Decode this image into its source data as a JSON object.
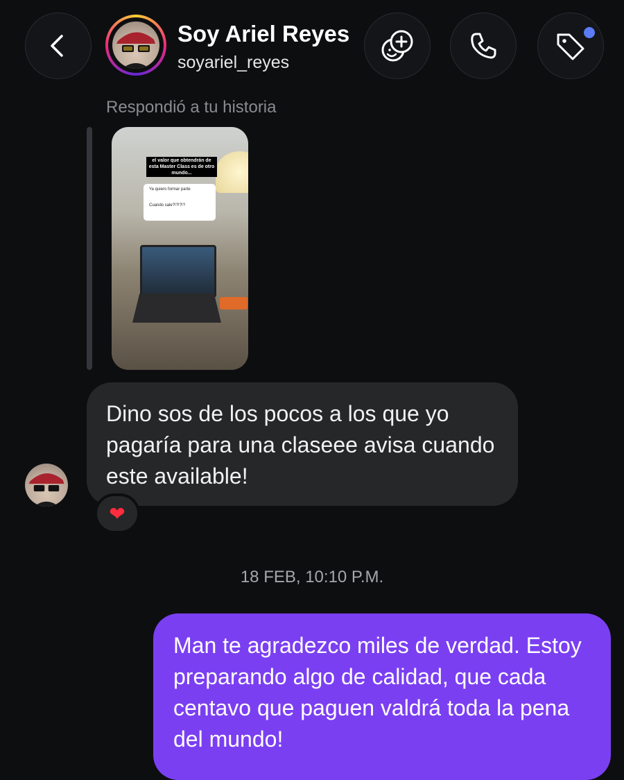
{
  "header": {
    "display_name": "Soy Ariel Reyes",
    "username": "soyariel_reyes"
  },
  "reply": {
    "label": "Respondió a tu historia",
    "story_caption": "el valor que obtendrán de esta Master Class es de otro mundo...",
    "story_card_option_1": "Ya quiero formar parte",
    "story_card_option_2": "Cuando sale?!?!?!?"
  },
  "messages": [
    {
      "from": "contact",
      "text": "Dino sos de los pocos a los que yo pagaría para una claseee avisa cuando este available!",
      "reaction": "❤"
    },
    {
      "from": "me",
      "text": "Man te agradezco miles de verdad. Estoy preparando algo de calidad, que cada centavo que paguen valdrá toda la pena del mundo!"
    }
  ],
  "timestamp": "18 FEB, 10:10 P.M.",
  "icons": {
    "back": "chevron-left-icon",
    "effects": "emoji-add-icon",
    "call": "phone-icon",
    "tag": "tag-icon"
  },
  "colors": {
    "background": "#0d0e10",
    "incoming_bubble": "#262729",
    "outgoing_bubble": "#7b3ff2",
    "notification_dot": "#5b7cf6"
  }
}
